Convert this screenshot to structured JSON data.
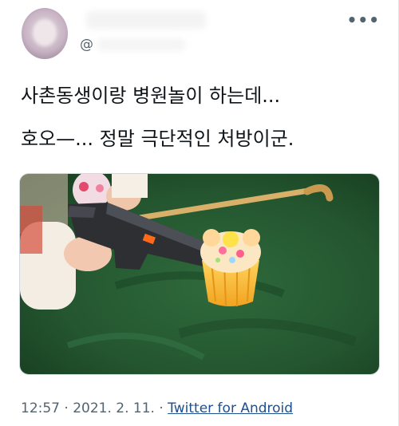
{
  "header": {
    "handle_prefix": "@",
    "more_label": "•••"
  },
  "tweet": {
    "lines": [
      "사촌동생이랑 병원놀이 하는데...",
      "호오—... 정말 극단적인 처방이군."
    ],
    "media": {
      "description_icon": "photo-icon"
    },
    "meta": {
      "time": "12:57",
      "separator": " · ",
      "date": "2021. 2. 11.",
      "separator2": " · ",
      "source": "Twitter for Android"
    }
  }
}
